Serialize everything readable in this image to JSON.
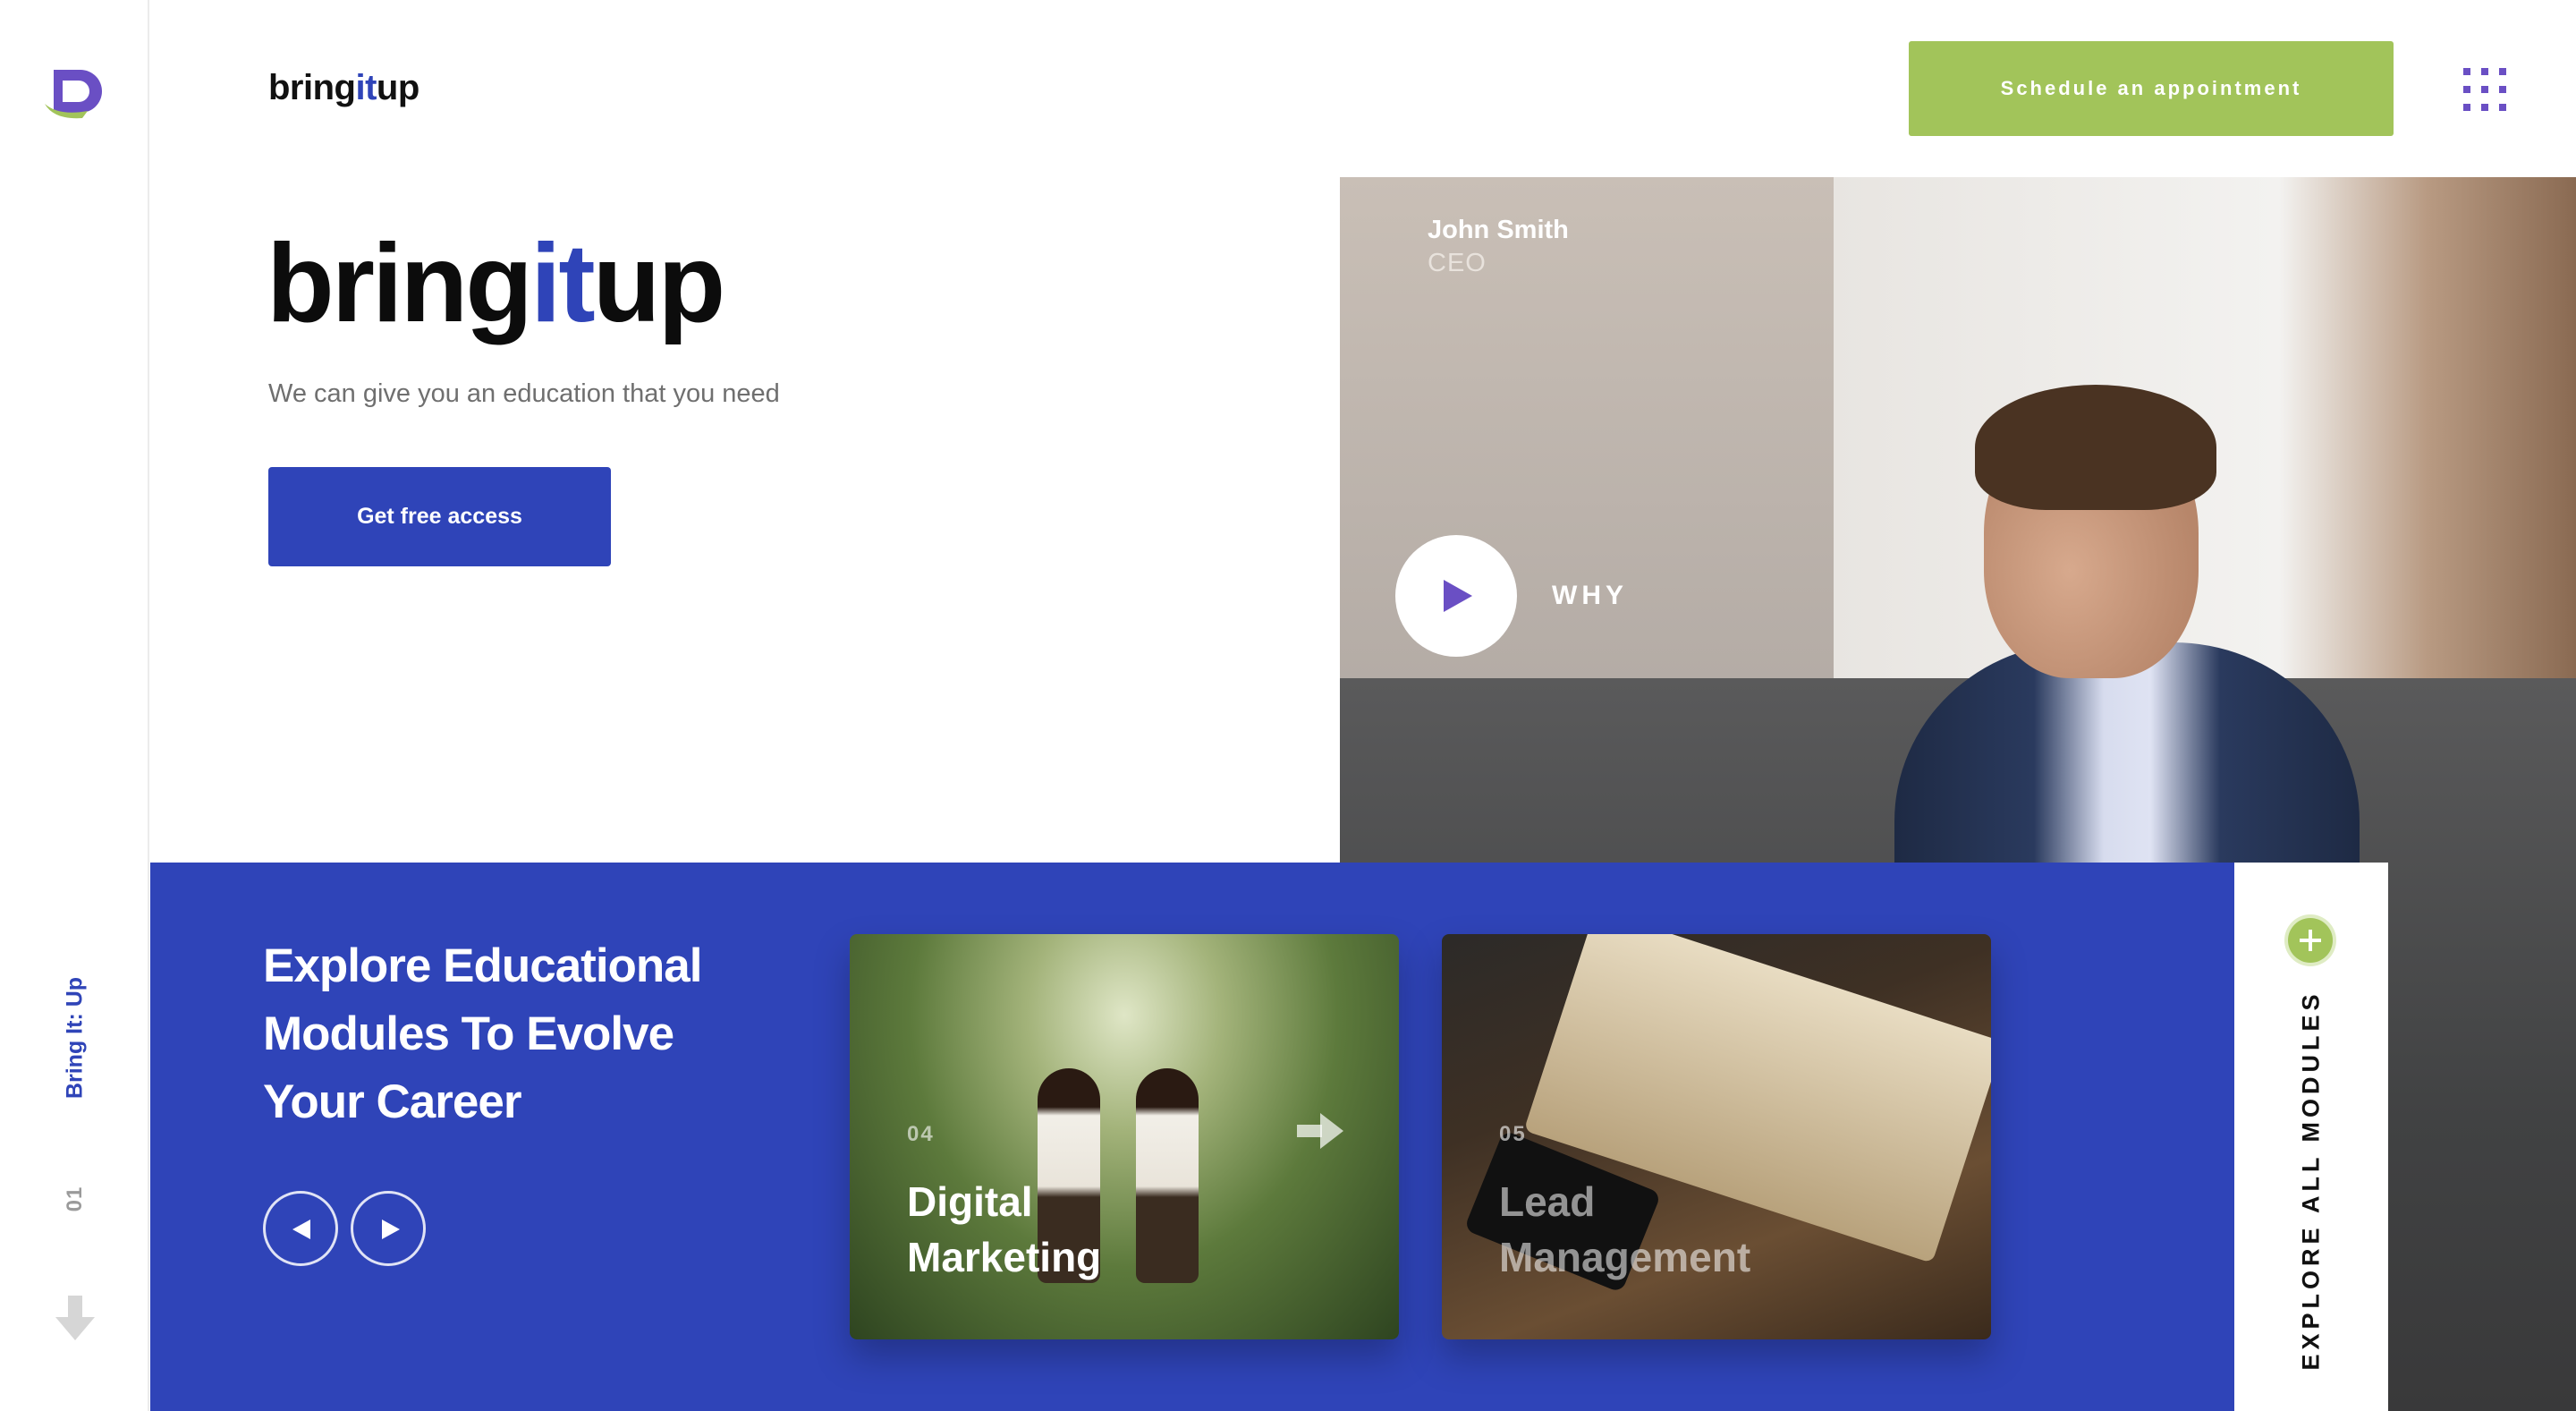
{
  "header": {
    "brand_pre": "bring",
    "brand_it": "it",
    "brand_post": "up",
    "cta_label": "Schedule an appointment"
  },
  "sidebar": {
    "vertical_label": "Bring It: Up",
    "page_number": "01"
  },
  "hero": {
    "title_pre": "bring",
    "title_it": "it",
    "title_post": "up",
    "subtitle": "We can give you an education that you need",
    "cta_label": "Get free access"
  },
  "video": {
    "person_name": "John Smith",
    "person_role": "CEO",
    "play_label": "WHY"
  },
  "modules": {
    "heading_lines": [
      "Explore Educational",
      "Modules To Evolve",
      "Your Career"
    ],
    "cards": [
      {
        "number": "04",
        "title_lines": [
          "Digital",
          "Marketing"
        ]
      },
      {
        "number": "05",
        "title_lines": [
          "Lead",
          "Management"
        ]
      }
    ],
    "explore_label": "EXPLORE ALL MODULES"
  },
  "colors": {
    "brand_blue": "#2f44b8",
    "accent_green": "#a2c45a",
    "accent_purple": "#6a4fc4"
  },
  "icons": [
    "logo-mark-icon",
    "grid-menu-icon",
    "down-arrow-icon",
    "play-icon",
    "arrow-left-icon",
    "arrow-right-icon",
    "plus-icon"
  ]
}
